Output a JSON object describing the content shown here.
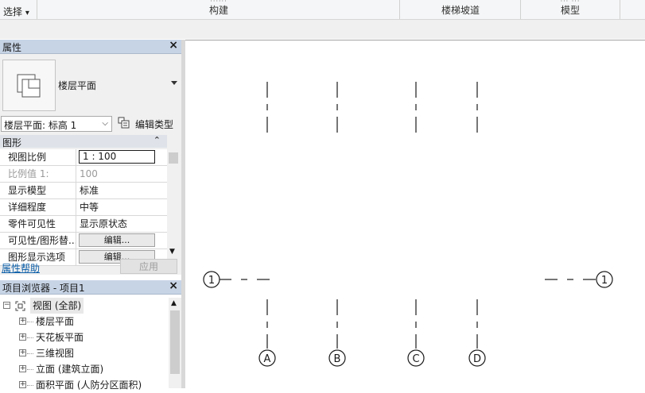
{
  "ribbon": {
    "select_label": "选择",
    "select_caret": "▾",
    "sections": [
      {
        "label": "构建",
        "dots": "······"
      },
      {
        "label": "楼梯坡道",
        "dots": ""
      },
      {
        "label": "模型",
        "dots": "···  ···"
      }
    ]
  },
  "properties": {
    "title": "属性",
    "close": "×",
    "type_name": "楼层平面",
    "view_selector": "楼层平面: 标高 1",
    "view_selector_caret": "⌵",
    "edit_type": "编辑类型",
    "group": "图形",
    "group_collapse": "⌃",
    "rows": [
      {
        "key": "视图比例",
        "value": "1 : 100",
        "style": "input"
      },
      {
        "key": "比例值 1:",
        "value": "100",
        "style": "gray"
      },
      {
        "key": "显示模型",
        "value": "标准",
        "style": "text"
      },
      {
        "key": "详细程度",
        "value": "中等",
        "style": "text"
      },
      {
        "key": "零件可见性",
        "value": "显示原状态",
        "style": "text"
      },
      {
        "key": "可见性/图形替...",
        "value": "编辑...",
        "style": "button"
      },
      {
        "key": "图形显示选项",
        "value": "编辑...",
        "style": "button"
      }
    ],
    "help": "属性帮助",
    "apply": "应用"
  },
  "browser": {
    "title": "项目浏览器 - 项目1",
    "close": "×",
    "root": "视图 (全部)",
    "items": [
      "楼层平面",
      "天花板平面",
      "三维视图",
      "立面 (建筑立面)",
      "面积平面 (人防分区面积)"
    ]
  },
  "drawing": {
    "vertical_grids": [
      "A",
      "B",
      "C",
      "D"
    ],
    "horizontal_grids": [
      "1"
    ],
    "line_color": "#1a1a1a"
  }
}
